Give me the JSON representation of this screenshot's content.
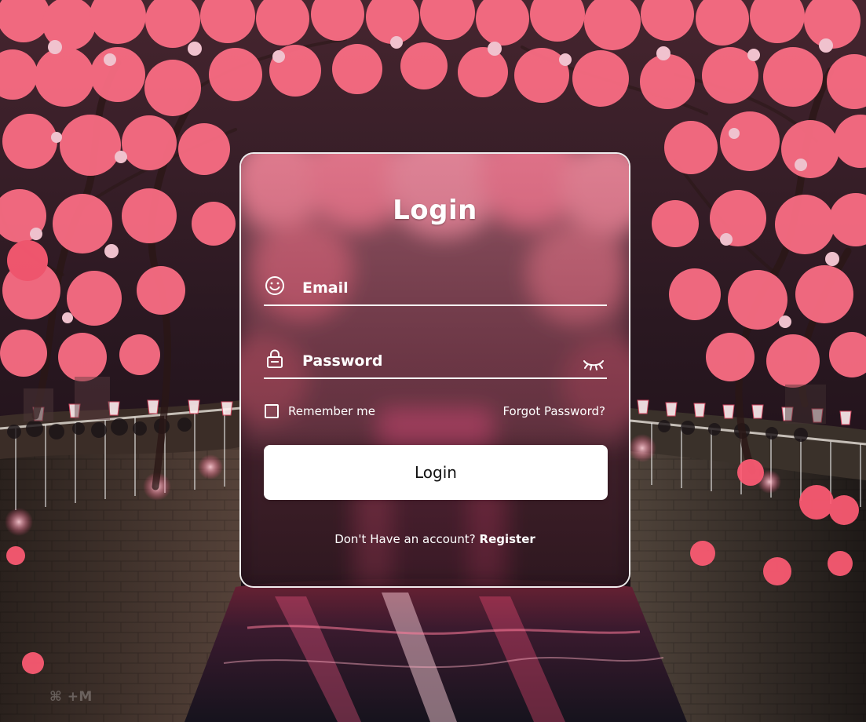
{
  "form": {
    "title": "Login",
    "email": {
      "placeholder": "Email",
      "value": ""
    },
    "password": {
      "placeholder": "Password",
      "value": ""
    },
    "remember_label": "Remember me",
    "forgot_label": "Forgot Password?",
    "login_button_label": "Login",
    "register_prompt": "Don't Have an account?",
    "register_label": "Register"
  },
  "icons": {
    "email": "smiley-face-icon",
    "password": "lock-icon",
    "show_password": "eye-closed-icon"
  },
  "colors": {
    "card_border": "#ffffff",
    "button_bg": "#ffffff",
    "button_text": "#111111",
    "text": "#ffffff"
  },
  "watermark": "⌘ +M"
}
